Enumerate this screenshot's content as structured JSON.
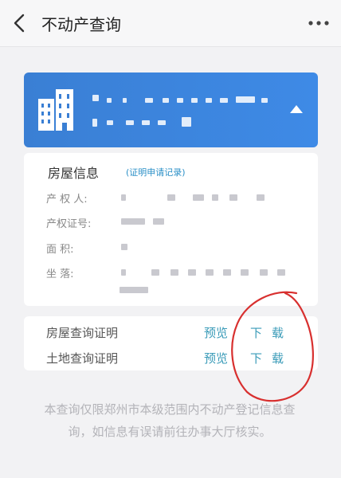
{
  "header": {
    "back_icon": "chevron-left-icon",
    "title": "不动产查询",
    "more_icon": "more-horizontal-icon"
  },
  "banner": {
    "icon": "building-icon",
    "collapse_icon": "caret-up-icon",
    "color": "#3a7fd4"
  },
  "property_info": {
    "section_title": "房屋信息",
    "record_link": "(证明申请记录)",
    "fields": [
      {
        "label": "产 权 人:"
      },
      {
        "label": "产权证号:"
      },
      {
        "label": "面    积:"
      },
      {
        "label": "坐    落:"
      }
    ]
  },
  "documents": [
    {
      "name": "房屋查询证明",
      "preview": "预览",
      "download": "下载"
    },
    {
      "name": "土地查询证明",
      "preview": "预览",
      "download": "下载"
    }
  ],
  "footer_note": "本查询仅限郑州市本级范围内不动产登记信息查询，如信息有误请前往办事大厅核实。",
  "colors": {
    "accent": "#3a9bb8",
    "link": "#2a8fc7",
    "annotation": "#d8302f"
  }
}
